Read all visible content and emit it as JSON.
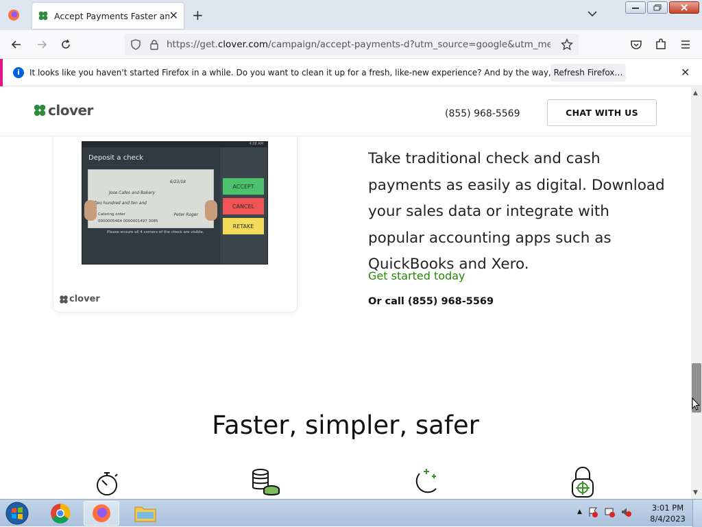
{
  "browser": {
    "tab_title": "Accept Payments Faster and Ea",
    "url_prefix": "https://get.",
    "url_domain": "clover.com",
    "url_rest": "/campaign/accept-payments-d?utm_source=google&utm_medium=pp"
  },
  "notification": {
    "message": "It looks like you haven't started Firefox in a while. Do you want to clean it up for a fresh, like-new experience? And by the way, welcome back!",
    "button_label": "Refresh Firefox…"
  },
  "site_header": {
    "logo_text": "clover",
    "phone": "(855) 968-5569",
    "chat_label": "CHAT WITH US"
  },
  "device_screen": {
    "title": "Deposit a check",
    "status_time": "4:38 AM",
    "check_payee": "Jose Cafes and Bakery",
    "check_amount_words": "Two hundred and ten and",
    "check_date": "6/23/18",
    "check_memo": "Catering order",
    "check_micr": "0000005464  0000001497  3085",
    "check_signature": "Peter Roger",
    "accept_label": "ACCEPT",
    "cancel_label": "CANCEL",
    "retake_label": "RETAKE",
    "hint": "Please ensure all 4 corners of the check are visible."
  },
  "card_logo_text": "clover",
  "content": {
    "body_text": "Take traditional check and cash payments as easily as digital. Download your sales data or integrate with popular accounting apps such as QuickBooks and Xero.",
    "cta_link": "Get started today",
    "or_call": "Or call (855) 968-5569"
  },
  "section": {
    "heading": "Faster, simpler, safer",
    "features": [
      "stopwatch-icon",
      "coins-icon",
      "moon-stars-icon",
      "lock-target-icon"
    ]
  },
  "taskbar": {
    "time": "3:01 PM",
    "date": "8/4/2023"
  },
  "colors": {
    "brand_green": "#228800",
    "notification_accent": "#e31587",
    "accept": "#4cc26c",
    "cancel": "#f05454",
    "retake": "#f2dc5a"
  }
}
